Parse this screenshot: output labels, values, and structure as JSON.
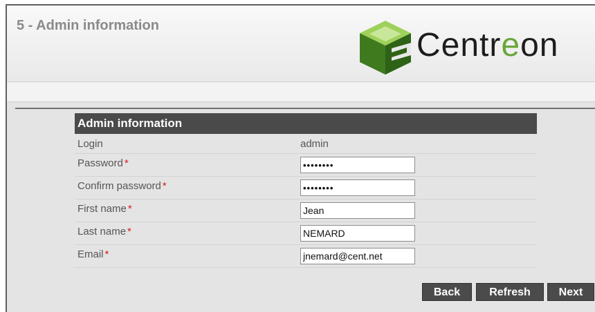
{
  "header": {
    "step_title": "5 - Admin information",
    "logo_text_prefix": "Centr",
    "logo_text_accent": "e",
    "logo_text_suffix": "on"
  },
  "panel": {
    "title": "Admin information",
    "login_label": "Login",
    "login_value": "admin",
    "fields": [
      {
        "label": "Password",
        "required_mark": "*",
        "value": "••••••••"
      },
      {
        "label": "Confirm password",
        "required_mark": "*",
        "value": "••••••••"
      },
      {
        "label": "First name",
        "required_mark": "*",
        "value": "Jean"
      },
      {
        "label": "Last name",
        "required_mark": "*",
        "value": "NEMARD"
      },
      {
        "label": "Email",
        "required_mark": "*",
        "value": "jnemard@cent.net"
      }
    ]
  },
  "buttons": {
    "back": "Back",
    "refresh": "Refresh",
    "next": "Next"
  },
  "colors": {
    "panel_header_bg": "#4a4a4a",
    "required": "#d81b1b",
    "logo_green": "#6aa63a",
    "button_bg": "#4b4b4b"
  }
}
